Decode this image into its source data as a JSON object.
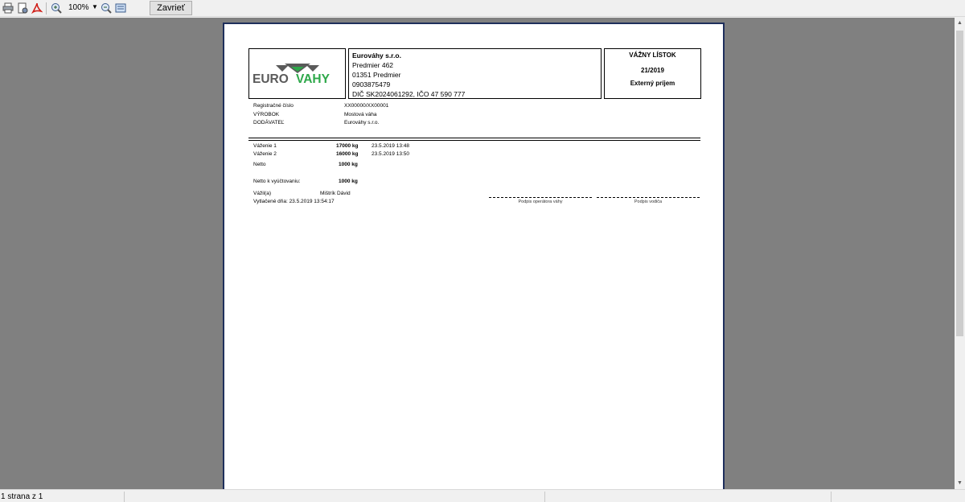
{
  "toolbar": {
    "zoom": "100%",
    "close_label": "Zavrieť"
  },
  "company": {
    "logo_text_left": "EURO",
    "logo_text_right": "VAHY",
    "name": "Eurováhy s.r.o.",
    "street": "Predmier  462",
    "city": "01351 Predmier",
    "phone": "0903875479",
    "ids": "DIČ SK2024061292, IČO 47 590 777"
  },
  "ticket": {
    "title": "VÁŽNY LÍSTOK",
    "number": "21/2019",
    "type": "Externý príjem"
  },
  "details": {
    "reg_label": "Registračné číslo",
    "reg_value": "XX00000/XX00001",
    "product_label": "VÝROBOK",
    "product_value": "Mostová váha",
    "supplier_label": "DODÁVATEĽ",
    "supplier_value": "Eurováhy s.r.o."
  },
  "weights": {
    "w1_label": "Váženie 1",
    "w1_value": "17000 kg",
    "w1_time": "23.5.2019 13:48",
    "w2_label": "Váženie 2",
    "w2_value": "16000 kg",
    "w2_time": "23.5.2019 13:50",
    "net_label": "Netto",
    "net_value": "1000 kg",
    "billing_label": "Netto k vyúčtovaniu:",
    "billing_value": "1000 kg"
  },
  "footer": {
    "weigher_label": "Vážil(a)",
    "weigher_name": "Mištrík Dávid",
    "printed": "Vytlačené dňa: 23.5.2019 13:54:17",
    "sig_operator": "Podpis operátora váhy",
    "sig_driver": "Podpis vodiča"
  },
  "status": {
    "page_info": "1 strana z 1"
  },
  "colors": {
    "logo_gray": "#5a5a5a",
    "logo_green": "#2ea84a",
    "page_border": "#1f2f5c",
    "viewer_bg": "#808080"
  }
}
